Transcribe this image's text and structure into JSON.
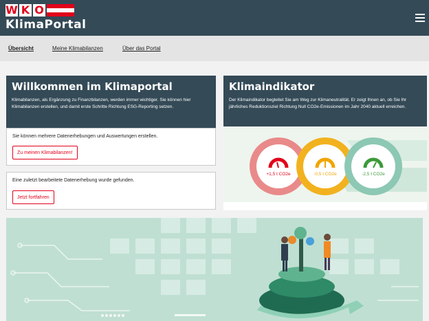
{
  "header": {
    "logo_letters": [
      "W",
      "K",
      "O"
    ],
    "logo_subtitle": "KlimaPortal",
    "flag_colors": [
      "#e2001a",
      "#ffffff",
      "#e2001a"
    ]
  },
  "nav": {
    "items": [
      "Übersicht",
      "Meine Klimabilanzen",
      "Über das Portal"
    ]
  },
  "welcome": {
    "title": "Willkommen im Klimaportal",
    "text": "Klimabilanzen, als Ergänzung zu Finanzbilanzen, werden immer wichtiger. Sie können hier Klimabilanzen erstellen, und damit erste Schritte Richtung ESG-Reporting setzen.",
    "section1_text": "Sie können mehrere Datenerhebungen und Auswertungen erstellen.",
    "section1_button": "Zu meinen Klimabilanzen!",
    "section2_text": "Eine zuletzt bearbeitete Datenerhebung wurde gefunden.",
    "section2_button": "Jetzt fortfahren"
  },
  "indicator": {
    "title": "Klimaindikator",
    "text": "Der Klimaindikator begleitet Sie am Weg zur Klimaneutralität. Er zeigt Ihnen an, ob Sie Ihr jährliches Reduktionsziel Richtung Null CO2e-Emissionen im Jahr 2040 aktuell erreichen.",
    "gauges": [
      {
        "value": "+1,5 t CO2e",
        "color": "#e2001a",
        "ring": "#e98a8a"
      },
      {
        "value": "-0,5 t CO2e",
        "color": "#f0a500",
        "ring": "#f2b21f"
      },
      {
        "value": "-2,5 t CO2e",
        "color": "#3d9a3a",
        "ring": "#8cc8b4"
      }
    ]
  },
  "colors": {
    "header_bg": "#344a57",
    "accent_red": "#e2001a"
  }
}
